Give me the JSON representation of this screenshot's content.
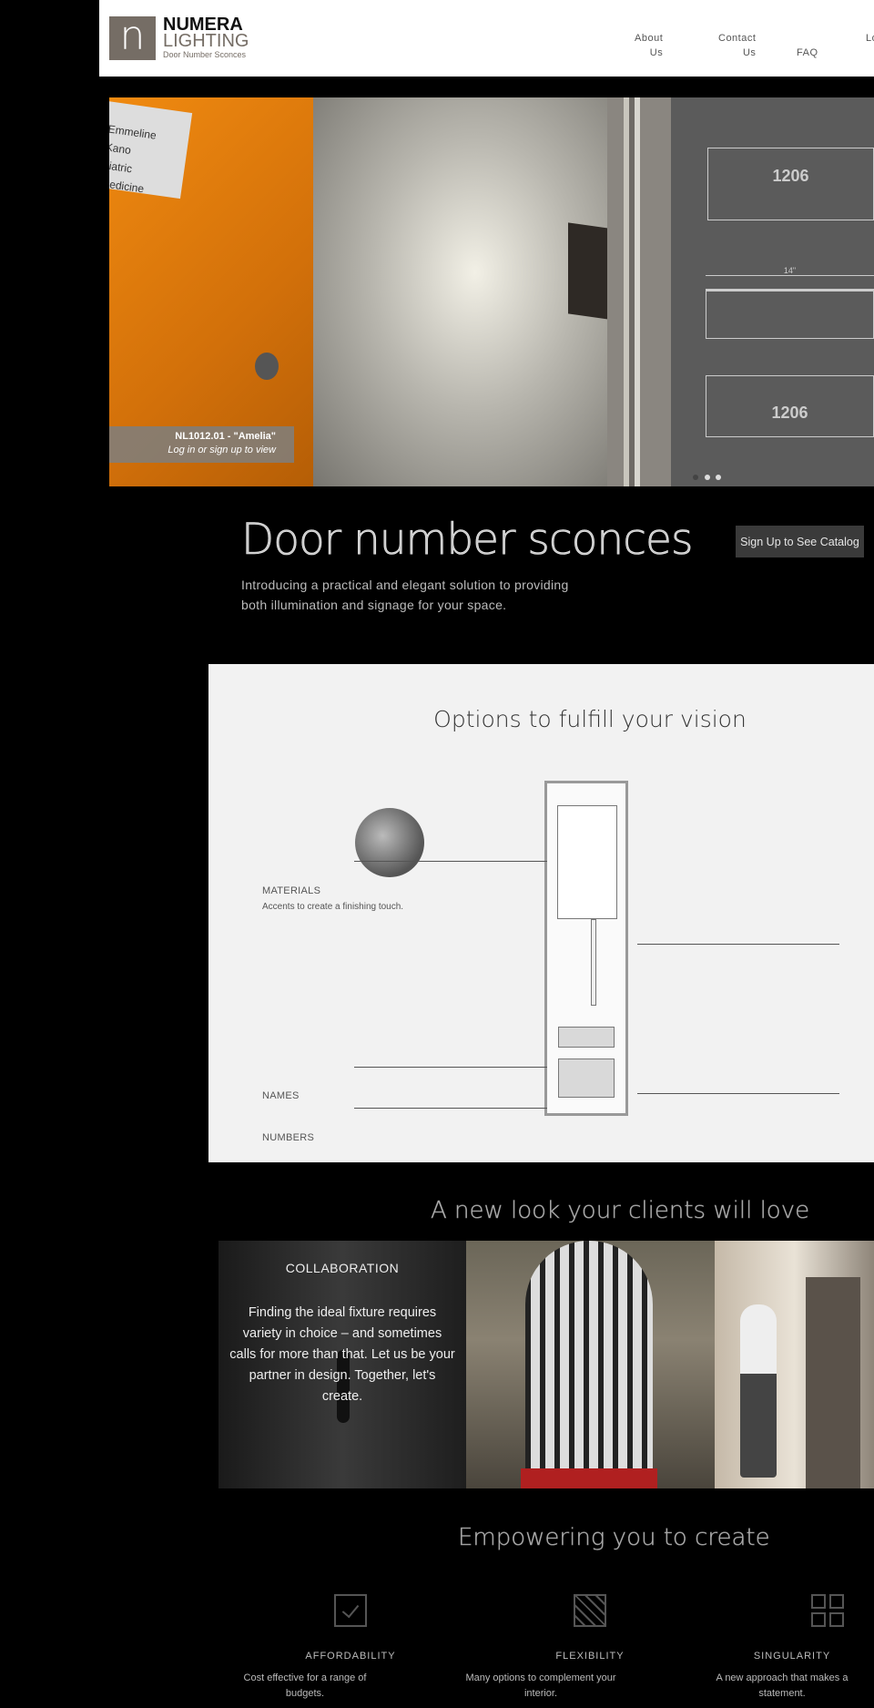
{
  "header": {
    "logo_letter": "n",
    "brand_line1": "NUMERA",
    "brand_line2": "LIGHTING",
    "tagline": "Door Number Sconces",
    "nav": [
      {
        "line1": "About",
        "line2": "Us"
      },
      {
        "line1": "Contact",
        "line2": "Us"
      },
      {
        "line1": "FAQ"
      },
      {
        "line1": "Lo"
      }
    ]
  },
  "hero": {
    "nameplate_line1": "Emmeline Kano",
    "nameplate_line2": "diatric Medicine",
    "sconce_number": "1206",
    "drawing_number": "1206",
    "drawing_dimension": "14\"",
    "caption_title": "NL1012.01 - \"Amelia\"",
    "caption_link": "Log in or sign up to view",
    "slide_count": 3,
    "active_slide": 1
  },
  "intro": {
    "title": "Door number sconces",
    "description": "Introducing a practical and elegant solution to providing both illumination and signage for your space.",
    "cta": "Sign Up to See Catalog"
  },
  "options": {
    "title": "Options to fulfill your vision",
    "materials_label": "MATERIALS",
    "materials_desc": "Accents to create a finishing touch.",
    "names_label": "NAMES",
    "numbers_label": "NUMBERS"
  },
  "showcase": {
    "title": "A new look your clients will love",
    "collab_title": "COLLABORATION",
    "collab_text": "Finding the ideal fixture requires variety in choice – and sometimes calls for more than that. Let us be your partner in design. Together, let's create."
  },
  "features": {
    "title": "Empowering you to create",
    "items": [
      {
        "icon": "checkbox-icon",
        "label": "AFFORDABILITY",
        "desc": "Cost effective for a range of budgets."
      },
      {
        "icon": "striped-square-icon",
        "label": "FLEXIBILITY",
        "desc": "Many options to complement your interior."
      },
      {
        "icon": "grid-icon",
        "label": "SINGULARITY",
        "desc": "A new approach that makes a statement."
      }
    ]
  },
  "colors": {
    "brand": "#756d65",
    "cta_bg": "#3a3a3a",
    "options_bg": "#f2f2f2"
  }
}
